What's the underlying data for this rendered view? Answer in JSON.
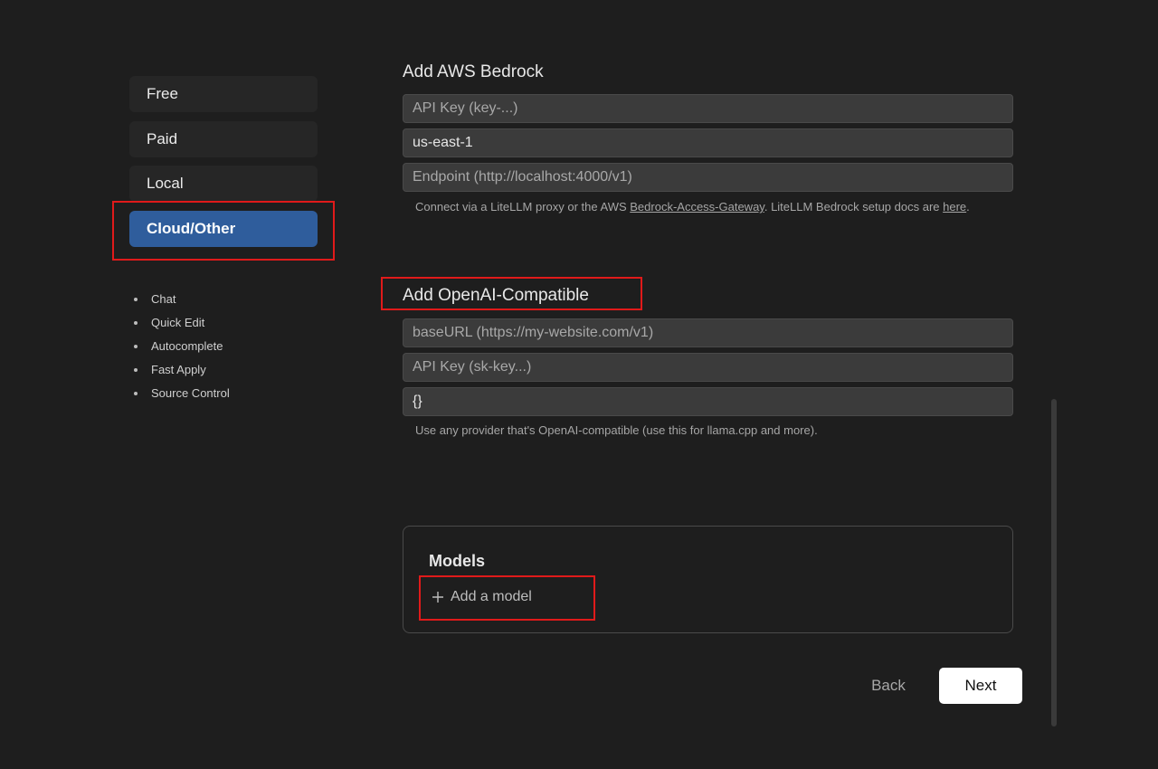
{
  "sidebar": {
    "tabs": [
      {
        "label": "Free"
      },
      {
        "label": "Paid"
      },
      {
        "label": "Local"
      },
      {
        "label": "Cloud/Other",
        "active": true
      }
    ],
    "features": [
      "Chat",
      "Quick Edit",
      "Autocomplete",
      "Fast Apply",
      "Source Control"
    ]
  },
  "bedrock": {
    "title": "Add AWS Bedrock",
    "api_key_placeholder": "API Key (key-...)",
    "region_value": "us-east-1",
    "endpoint_placeholder": "Endpoint (http://localhost:4000/v1)",
    "hint_pre": "Connect via a LiteLLM proxy or the AWS ",
    "hint_link": "Bedrock-Access-Gateway",
    "hint_mid": ". LiteLLM Bedrock setup docs are ",
    "hint_link2": "here",
    "hint_post": "."
  },
  "openai_compat": {
    "title": "Add OpenAI-Compatible",
    "base_url_placeholder": "baseURL (https://my-website.com/v1)",
    "api_key_placeholder": "API Key (sk-key...)",
    "headers_value": "{}",
    "hint": "Use any provider that's OpenAI-compatible (use this for llama.cpp and more)."
  },
  "models": {
    "title": "Models",
    "add_label": "Add a model"
  },
  "footer": {
    "back_label": "Back",
    "next_label": "Next"
  },
  "colors": {
    "background": "#1e1e1e",
    "active_tab": "#2f5d9c",
    "annotation": "#e01a1a"
  }
}
